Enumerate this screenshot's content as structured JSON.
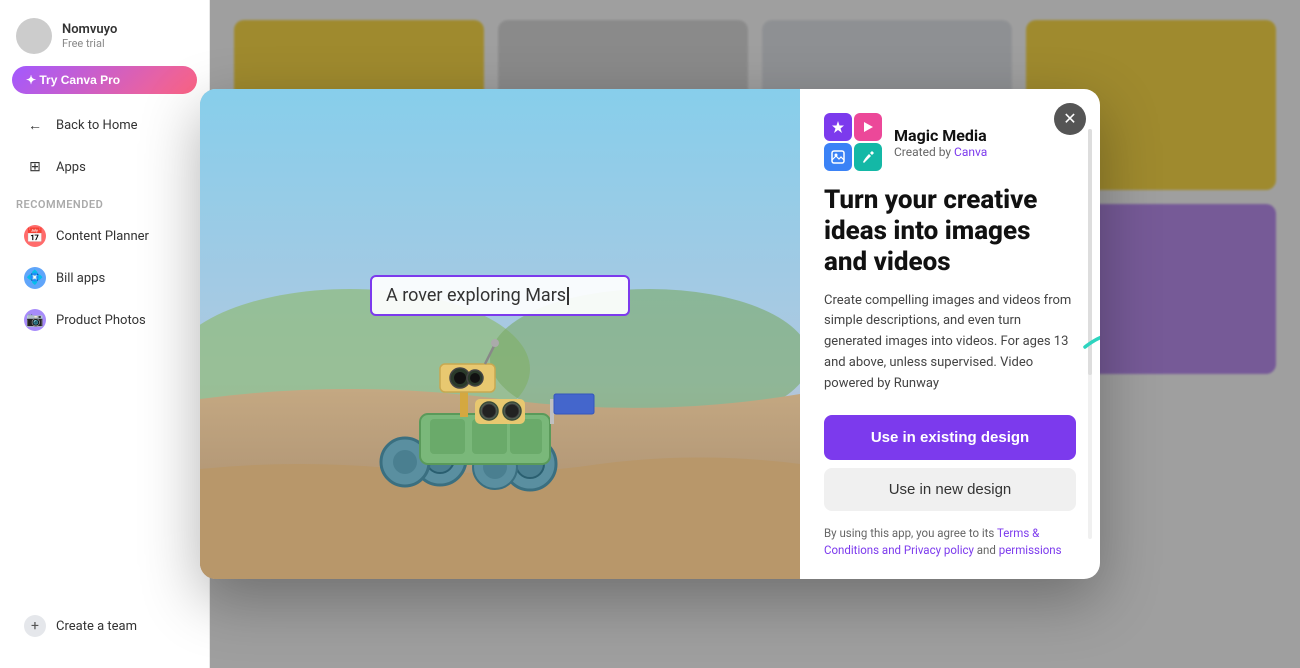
{
  "sidebar": {
    "user": {
      "name": "Nomvuyo",
      "subtitle": "Free trial"
    },
    "tryCanvaBtn": "✦ Try Canva Pro",
    "navItems": [
      {
        "id": "back-home",
        "label": "Back to Home",
        "icon": "←"
      },
      {
        "id": "apps",
        "label": "Apps",
        "icon": "⊞"
      }
    ],
    "sectionLabel": "Recommended",
    "recommendedItems": [
      {
        "id": "content-planner",
        "label": "Content Planner",
        "icon": "📅"
      },
      {
        "id": "bill-apps",
        "label": "Bill apps",
        "icon": "💠"
      },
      {
        "id": "product-photos",
        "label": "Product Photos",
        "icon": "📷"
      }
    ],
    "bottomItems": [
      {
        "id": "create-team",
        "label": "Create a team",
        "icon": "+"
      }
    ]
  },
  "modal": {
    "app": {
      "name": "Magic Media",
      "createdBy": "Created by",
      "creatorLink": "Canva"
    },
    "title": "Turn your creative ideas into images and videos",
    "description": "Create compelling images and videos from simple descriptions, and even turn generated images into videos. For ages 13 and above, unless supervised. Video powered by Runway",
    "imagePrompt": "A rover exploring Mars",
    "buttons": {
      "useExisting": "Use in existing design",
      "useNew": "Use in new design"
    },
    "terms": {
      "prefix": "By using this app, you agree to its ",
      "linkTerms": "Terms & Conditions and Privacy policy",
      "middle": " and ",
      "linkPermissions": "permissions"
    }
  },
  "bgCards": {
    "row1": [
      "yellow",
      "gray",
      "teal",
      "green"
    ],
    "row2": [
      "pink",
      "purple",
      "blue",
      "orange"
    ]
  },
  "colors": {
    "accent": "#7c3aed",
    "arrowTeal": "#2dd4bf"
  }
}
